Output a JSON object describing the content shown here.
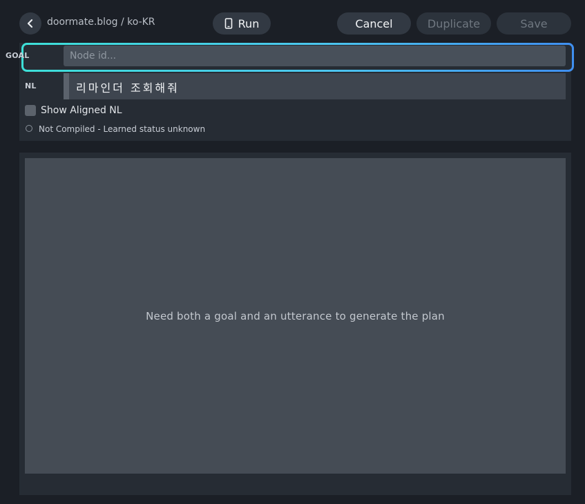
{
  "header": {
    "breadcrumb": "doormate.blog / ko-KR",
    "run_label": "Run",
    "cancel_label": "Cancel",
    "duplicate_label": "Duplicate",
    "save_label": "Save"
  },
  "form": {
    "goal_label": "GOAL",
    "goal_placeholder": "Node id...",
    "goal_value": "",
    "nl_label": "NL",
    "nl_value": "리마인더 조회해줘",
    "show_aligned_label": "Show Aligned NL",
    "show_aligned_checked": false,
    "status_text": "Not Compiled - Learned status unknown"
  },
  "plan": {
    "empty_message": "Need both a goal and an utterance to generate the plan"
  },
  "icons": {
    "back": "chevron-left-icon",
    "run": "phone-icon",
    "status": "circle-outline-icon"
  },
  "colors": {
    "focus_ring_start": "#3de0d8",
    "focus_ring_end": "#3f8ff0",
    "background": "#1b1f26",
    "panel": "#262c34"
  }
}
